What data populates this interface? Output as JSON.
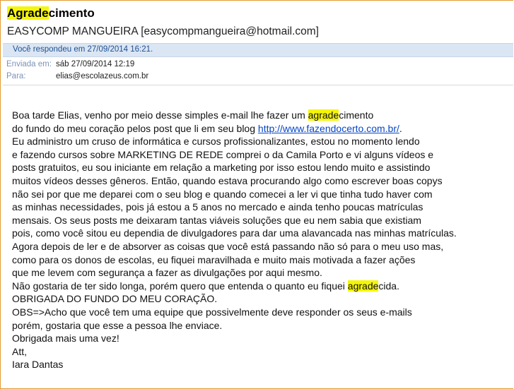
{
  "header": {
    "subject_prefix": "Agrade",
    "subject_rest": "cimento",
    "from": "EASYCOMP MANGUEIRA [easycompmangueira@hotmail.com]",
    "info_bar": "Você respondeu em 27/09/2014 16:21.",
    "sent_label": "Enviada em:",
    "sent_value": "sáb 27/09/2014 12:19",
    "to_label": "Para:",
    "to_value": "elias@escolazeus.com.br"
  },
  "body": {
    "line1_a": "Boa tarde Elias, venho por meio desse simples e-mail lhe fazer um ",
    "line1_hl": "agrade",
    "line1_b": "cimento",
    "line2_a": "do fundo do meu coração pelos post que li em seu blog ",
    "line2_link": "http://www.fazendocerto.com.br/",
    "line2_b": ".",
    "lines_mid": [
      "Eu administro um cruso de informática e cursos profissionalizantes, estou no momento lendo",
      "e fazendo cursos sobre MARKETING DE REDE comprei o da Camila Porto e vi alguns vídeos e",
      "posts gratuitos, eu sou iniciante em relação a marketing por isso estou lendo muito e assistindo",
      "muitos vídeos desses gêneros. Então, quando estava procurando algo como escrever boas copys",
      "não sei por que me deparei com o seu blog e quando comecei a ler vi que tinha tudo haver com",
      "as minhas necessidades, pois já estou a 5 anos no mercado e ainda tenho poucas matrículas",
      "mensais. Os seus posts me deixaram tantas viáveis soluções que eu nem sabia que existiam",
      "pois, como você sitou eu dependia de divulgadores para dar uma alavancada nas minhas matrículas.",
      "Agora depois de ler e de absorver as coisas que você está passando não só para o meu uso mas,",
      "como para os donos de escolas, eu fiquei maravilhada e muito mais motivada a fazer ações",
      "que me levem com segurança a fazer as divulgações por aqui mesmo."
    ],
    "line14_a": "Não gostaria de ter sido longa, porém quero que entenda o quanto eu fiquei ",
    "line14_hl": "agrade",
    "line14_b": "cida.",
    "lines_end": [
      "OBRIGADA DO FUNDO DO MEU CORAÇÃO.",
      "OBS=>Acho que você tem uma equipe que possivelmente deve responder os seus e-mails",
      "porém, gostaria que esse a pessoa lhe enviace.",
      "Obrigada mais uma vez!",
      "Att,",
      "Iara Dantas"
    ]
  }
}
